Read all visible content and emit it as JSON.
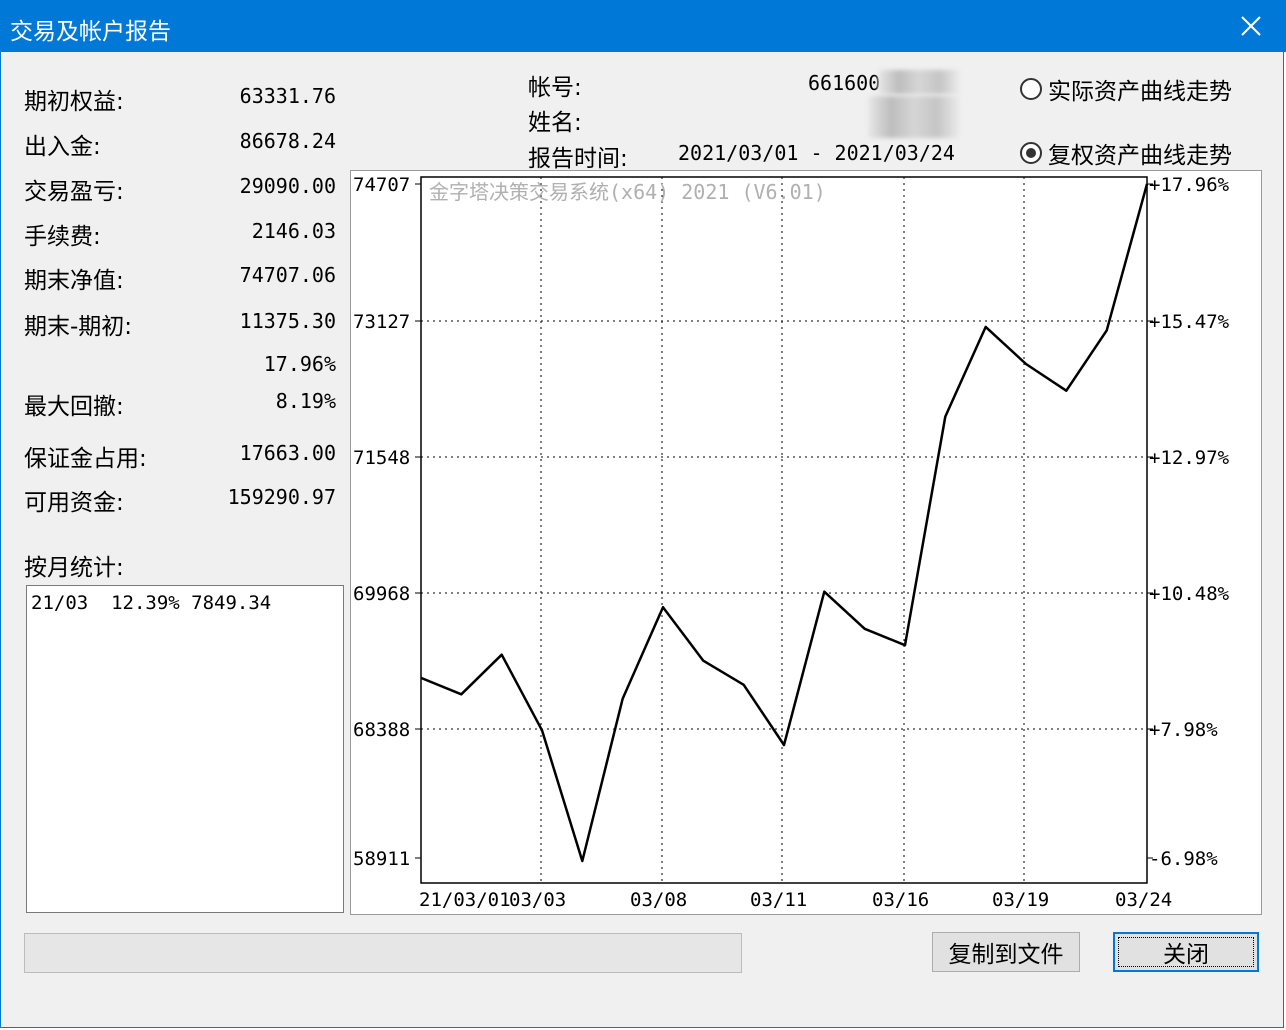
{
  "window": {
    "title": "交易及帐户报告"
  },
  "summary": [
    {
      "label": "期初权益:",
      "value": "63331.76"
    },
    {
      "label": "出入金:",
      "value": "86678.24"
    },
    {
      "label": "交易盈亏:",
      "value": "29090.00"
    },
    {
      "label": "手续费:",
      "value": "2146.03"
    },
    {
      "label": "期末净值:",
      "value": "74707.06"
    },
    {
      "label": "期末-期初:",
      "value": "11375.30"
    },
    {
      "label": "",
      "value": "17.96%"
    },
    {
      "label": "最大回撤:",
      "value": "8.19%"
    },
    {
      "label": "保证金占用:",
      "value": "17663.00"
    },
    {
      "label": "可用资金:",
      "value": "159290.97"
    }
  ],
  "account": {
    "account_label": "帐号:",
    "account_value": "661600",
    "name_label": "姓名:",
    "period_label": "报告时间:",
    "period_value": "2021/03/01 - 2021/03/24"
  },
  "radios": {
    "actual": {
      "label": "实际资产曲线走势",
      "checked": false
    },
    "adjusted": {
      "label": "复权资产曲线走势",
      "checked": true
    }
  },
  "monthly": {
    "label": "按月统计:",
    "items": [
      "21/03  12.39% 7849.34"
    ]
  },
  "buttons": {
    "copy": "复制到文件",
    "close": "关闭"
  },
  "chart_data": {
    "type": "line",
    "watermark": "金字塔决策交易系统(x64) 2021 (V6.01)",
    "y_ticks_left": [
      "74707",
      "73127",
      "71548",
      "69968",
      "68388",
      "58911"
    ],
    "y_ticks_right": [
      "+17.96%",
      "+15.47%",
      "+12.97%",
      "+10.48%",
      "+7.98%",
      "-6.98%"
    ],
    "x_ticks": [
      "21/03/01",
      "03/03",
      "03/08",
      "03/11",
      "03/16",
      "03/19",
      "03/24"
    ],
    "series": [
      {
        "color": "#000000",
        "values": [
          68980,
          68790,
          69250,
          68290,
          67220,
          68740,
          69800,
          69180,
          68900,
          67820,
          69980,
          69550,
          69360,
          72010,
          73050,
          72620,
          72310,
          73010,
          74707
        ]
      }
    ]
  }
}
